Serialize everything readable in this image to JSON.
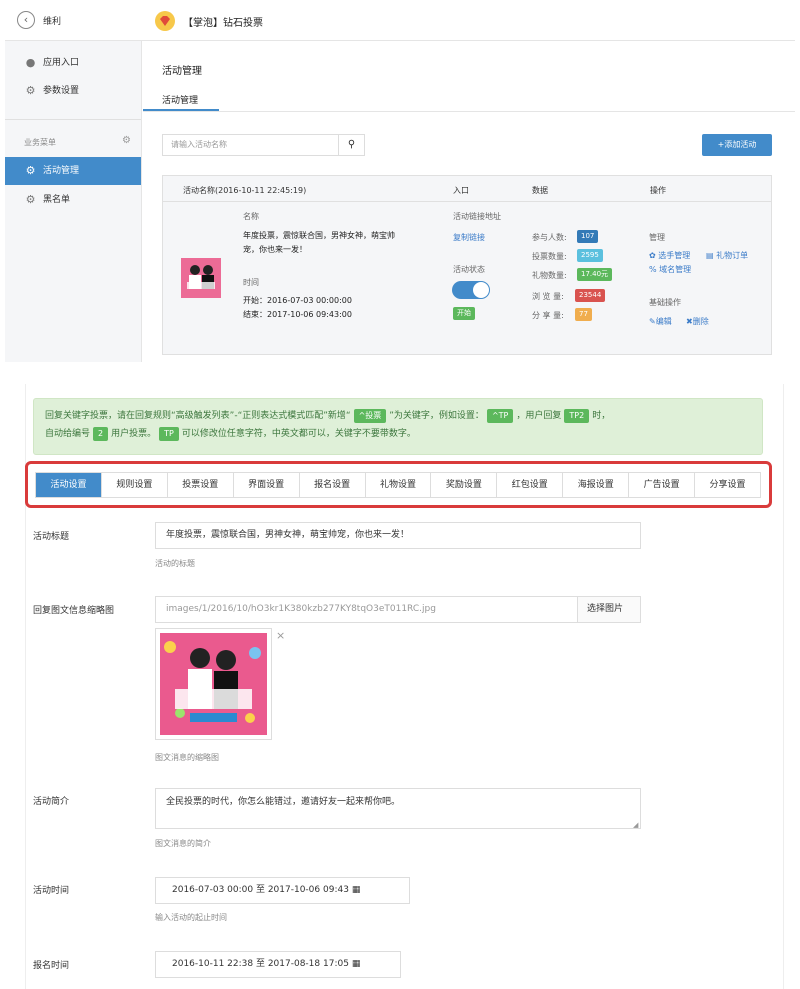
{
  "topbar": {
    "back_label": "维利",
    "app_title": "【掌泡】钻石投票"
  },
  "sidebar": {
    "items": [
      {
        "label": "应用入口"
      },
      {
        "label": "参数设置"
      }
    ],
    "section_title": "业务菜单",
    "menu": [
      {
        "label": "活动管理"
      },
      {
        "label": "黑名单"
      }
    ]
  },
  "main": {
    "page_title": "活动管理",
    "tab_label": "活动管理",
    "search_placeholder": "请输入活动名称",
    "add_button": "+添加活动",
    "table": {
      "col_activity": "活动名称(2016-10-11 22:45:19)",
      "col_entry": "入口",
      "col_data": "数据",
      "col_ops": "操作"
    },
    "row": {
      "name_label": "名称",
      "name_line1": "年度投票，震惊联合国，男神女神，萌宝帅",
      "name_line2": "宠，你也来一发！",
      "time_label": "时间",
      "start": "开始：2016-07-03 00:00:00",
      "end": "结束：2017-10-06 09:43:00",
      "entry_link_label": "活动链接地址",
      "copy_link": "复制链接",
      "status_label": "活动状态",
      "status_badge": "开始",
      "stats": [
        {
          "label": "参与人数:",
          "value": "107"
        },
        {
          "label": "投票数量:",
          "value": "2595"
        },
        {
          "label": "礼物数量:",
          "value": "17.40元"
        },
        {
          "label": "浏 览 量:",
          "value": "23544"
        },
        {
          "label": "分 享 量:",
          "value": "77"
        }
      ],
      "manage_label": "管理",
      "manage_links": [
        "选手管理",
        "礼物订单",
        "域名管理"
      ],
      "basic_label": "基础操作",
      "edit": "编辑",
      "delete": "删除"
    }
  },
  "notice": {
    "p1": "回复关键字投票，请在回复规则“高级触发列表”-“正则表达式模式匹配”新增“",
    "tag1": "^投票",
    "p2": "”为关键字，例如设置：",
    "tag2": "^TP",
    "p3": "，用户回复",
    "tag3": "TP2",
    "p4": "时，",
    "p5": "自动给编号",
    "tag4": "2",
    "p6": "用户投票。",
    "tag5": "TP",
    "p7": "可以修改位任意字符，中英文都可以，关键字不要带数字。"
  },
  "tabs": [
    "活动设置",
    "规则设置",
    "投票设置",
    "界面设置",
    "报名设置",
    "礼物设置",
    "奖励设置",
    "红包设置",
    "海报设置",
    "广告设置",
    "分享设置"
  ],
  "form": {
    "title_label": "活动标题",
    "title_value": "年度投票，震惊联合国，男神女神，萌宝帅宠，你也来一发！",
    "title_help": "活动的标题",
    "thumb_label": "回复图文信息缩略图",
    "thumb_value": "images/1/2016/10/hO3kr1K380kzb277KY8tqO3eT011RC.jpg",
    "thumb_button": "选择图片",
    "thumb_help": "图文消息的缩略图",
    "intro_label": "活动简介",
    "intro_value": "全民投票的时代，你怎么能错过，邀请好友一起来帮你吧。",
    "intro_help": "图文消息的简介",
    "time_label": "活动时间",
    "time_value": "2016-07-03 00:00 至 2017-10-06 09:43",
    "time_help": "输入活动的起止时间",
    "signup_label": "报名时间",
    "signup_value": "2016-10-11 22:38 至 2017-08-18 17:05"
  }
}
